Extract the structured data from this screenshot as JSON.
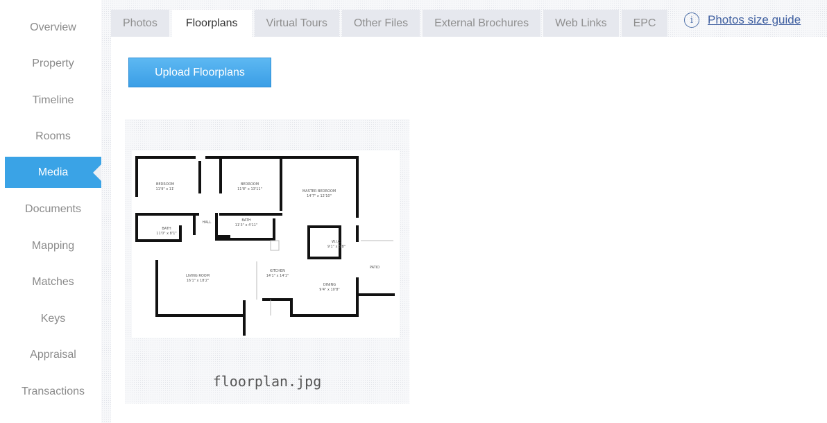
{
  "sidebar": {
    "items": [
      {
        "label": "Overview"
      },
      {
        "label": "Property"
      },
      {
        "label": "Timeline"
      },
      {
        "label": "Rooms"
      },
      {
        "label": "Media",
        "active": true
      },
      {
        "label": "Documents"
      },
      {
        "label": "Mapping"
      },
      {
        "label": "Matches"
      },
      {
        "label": "Keys"
      },
      {
        "label": "Appraisal"
      },
      {
        "label": "Transactions"
      }
    ]
  },
  "tabs": [
    {
      "label": "Photos"
    },
    {
      "label": "Floorplans",
      "active": true
    },
    {
      "label": "Virtual Tours"
    },
    {
      "label": "Other Files"
    },
    {
      "label": "External Brochures"
    },
    {
      "label": "Web Links"
    },
    {
      "label": "EPC"
    }
  ],
  "guide": {
    "icon": "info-icon",
    "label": "Photos size guide"
  },
  "upload": {
    "label": "Upload Floorplans"
  },
  "files": [
    {
      "name": "floorplan.jpg",
      "rooms": [
        {
          "label": "BEDROOM",
          "dims": "11'9\" x 11'"
        },
        {
          "label": "BEDROOM",
          "dims": "11'8\" x 13'11\""
        },
        {
          "label": "MASTER BEDROOM",
          "dims": "14'7\" x 12'10\""
        },
        {
          "label": "BATH",
          "dims": "11'0\" x 8'1\""
        },
        {
          "label": "HALL",
          "dims": ""
        },
        {
          "label": "BATH",
          "dims": "11'3\" x 4'11\""
        },
        {
          "label": "W.I.C.",
          "dims": "9'1\" x 5'8\""
        },
        {
          "label": "LIVING ROOM",
          "dims": "16'1\" x 18'2\""
        },
        {
          "label": "KITCHEN",
          "dims": "14'1\" x 14'1\""
        },
        {
          "label": "DINING",
          "dims": "9'4\" x 10'8\""
        },
        {
          "label": "PATIO",
          "dims": ""
        }
      ]
    }
  ],
  "colors": {
    "accent": "#3aa3e6",
    "link": "#3f5fa0",
    "muted_text": "#8a8a8a"
  }
}
